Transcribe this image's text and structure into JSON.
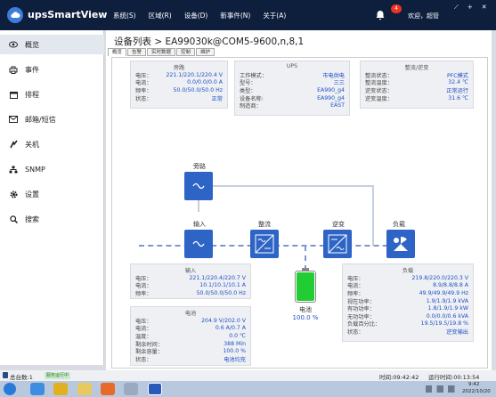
{
  "app": {
    "title": "upsSmartView"
  },
  "menu": [
    "系统(S)",
    "区域(R)",
    "设备(D)",
    "新事件(N)",
    "关于(A)"
  ],
  "header": {
    "notification_count": "4",
    "welcome": "欢迎，超管",
    "window_buttons": [
      "⟋",
      "+",
      "✕"
    ]
  },
  "sidebar": {
    "items": [
      {
        "label": "概览",
        "icon": "eye-icon"
      },
      {
        "label": "事件",
        "icon": "printer-icon"
      },
      {
        "label": "排程",
        "icon": "calendar-icon"
      },
      {
        "label": "邮箱/短信",
        "icon": "mail-icon"
      },
      {
        "label": "关机",
        "icon": "power-icon"
      },
      {
        "label": "SNMP",
        "icon": "network-icon"
      },
      {
        "label": "设置",
        "icon": "gear-icon"
      },
      {
        "label": "搜索",
        "icon": "search-icon"
      }
    ]
  },
  "main": {
    "title": "设备列表 > EA99030k@COM5-9600,n,8,1",
    "tabs": [
      "概览",
      "告警",
      "实时数据",
      "控制",
      "维护"
    ]
  },
  "cards": {
    "bypass": {
      "title": "旁路",
      "rows": [
        {
          "k": "电压：",
          "v": "221.1/220.1/220.4 V"
        },
        {
          "k": "电流：",
          "v": "0.0/0.0/0.0 A"
        },
        {
          "k": "频率：",
          "v": "50.0/50.0/50.0 Hz"
        },
        {
          "k": "状态：",
          "v": "正常"
        }
      ]
    },
    "ups": {
      "title": "UPS",
      "rows": [
        {
          "k": "工作模式：",
          "v": "市电供电"
        },
        {
          "k": "型号：",
          "v": "三三"
        },
        {
          "k": "类型：",
          "v": "EA990_g4"
        },
        {
          "k": "设备名称:",
          "v": "EA990_g4"
        },
        {
          "k": "制造商：",
          "v": "EAST"
        }
      ]
    },
    "rectifier": {
      "title": "整流/逆变",
      "rows": [
        {
          "k": "整流状态：",
          "v": "PFC模式"
        },
        {
          "k": "整流温度：",
          "v": "32.4 ℃"
        },
        {
          "k": "逆变状态：",
          "v": "正常运行"
        },
        {
          "k": "逆变温度：",
          "v": "31.6 ℃"
        }
      ]
    },
    "input": {
      "title": "输入",
      "rows": [
        {
          "k": "电压：",
          "v": "221.1/220.4/220.7 V"
        },
        {
          "k": "电流：",
          "v": "10.1/10.1/10.1 A"
        },
        {
          "k": "频率：",
          "v": "50.0/50.0/50.0 Hz"
        }
      ]
    },
    "battery": {
      "title": "电池",
      "rows": [
        {
          "k": "电压：",
          "v": "204.9 V/202.0 V"
        },
        {
          "k": "电流：",
          "v": "0.6 A/0.7 A"
        },
        {
          "k": "温度：",
          "v": "0.0 ℃"
        },
        {
          "k": "剩余时间：",
          "v": "388 Min"
        },
        {
          "k": "剩余容量：",
          "v": "100.0 %"
        },
        {
          "k": "状态：",
          "v": "电池均充"
        }
      ]
    },
    "load": {
      "title": "负载",
      "rows": [
        {
          "k": "电压：",
          "v": "219.8/220.0/220.3 V"
        },
        {
          "k": "电流：",
          "v": "8.9/8.8/8.8 A"
        },
        {
          "k": "频率：",
          "v": "49.9/49.9/49.9 Hz"
        },
        {
          "k": "视在功率：",
          "v": "1.9/1.9/1.9 kVA"
        },
        {
          "k": "有功功率：",
          "v": "1.8/1.9/1.9 kW"
        },
        {
          "k": "无功功率：",
          "v": "0.0/0.0/0.6 kVA"
        },
        {
          "k": "负载百分比：",
          "v": "19.5/19.5/19.8 %"
        },
        {
          "k": "状态：",
          "v": "逆变输出"
        }
      ]
    }
  },
  "diagram": {
    "bypass_label": "旁路",
    "input_label": "输入",
    "rectifier_label": "整流",
    "inverter_label": "逆变",
    "load_label": "负载",
    "battery_label": "电池",
    "battery_percent": "100.0 %",
    "battery_level": 1.0
  },
  "statusbar": {
    "total_label": "总台数:1",
    "service_status": "服务运行中",
    "time": "时间:09:42:42",
    "run_time": "运行时间:00:13:54"
  },
  "taskbar": {
    "clock_time": "9:42",
    "clock_date": "2022/10/20"
  },
  "colors": {
    "accent": "#2e64c5",
    "topbar": "#0e1e3d",
    "value_text": "#2050c8",
    "battery": "#22cc33"
  }
}
